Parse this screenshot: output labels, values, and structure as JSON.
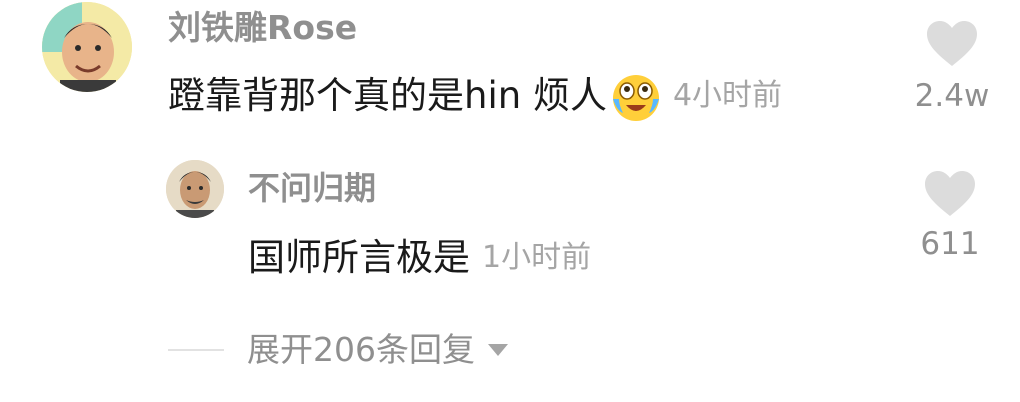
{
  "comment": {
    "username": "刘铁雕Rose",
    "text": "蹬靠背那个真的是hin 烦人",
    "emoji": "crying-laughing-emoji",
    "time": "4小时前",
    "like_count": "2.4w",
    "like_icon": "heart-icon"
  },
  "reply": {
    "username": "不问归期",
    "text": "国师所言极是",
    "time": "1小时前",
    "like_count": "611",
    "like_icon": "heart-icon"
  },
  "expand": {
    "label": "展开206条回复",
    "icon": "chevron-down-icon"
  },
  "colors": {
    "username": "#8f8f8f",
    "text": "#1a1a1a",
    "time": "#a5a5a5",
    "heart": "#dcdcdc",
    "background": "#ffffff"
  }
}
